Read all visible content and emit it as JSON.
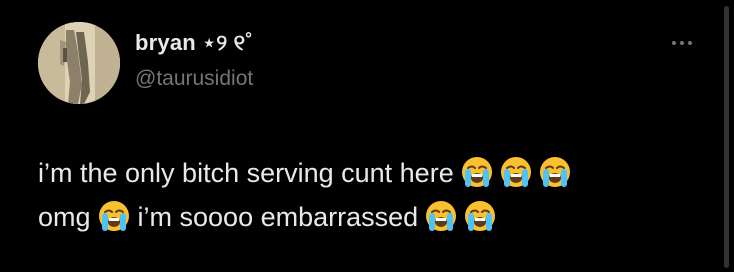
{
  "tweet": {
    "display_name": "bryan ⋆୨ ୧˚",
    "handle": "@taurusidiot",
    "text_line1": "i’m the only bitch serving cunt here",
    "text_line2a": "omg",
    "text_line2b": "i’m soooo embarrassed",
    "emoji_name": "loudly-crying-face",
    "more_icon": "more-horizontal-icon"
  },
  "colors": {
    "background": "#000000",
    "text": "#e7e9ea",
    "secondary_text": "#71767b"
  }
}
